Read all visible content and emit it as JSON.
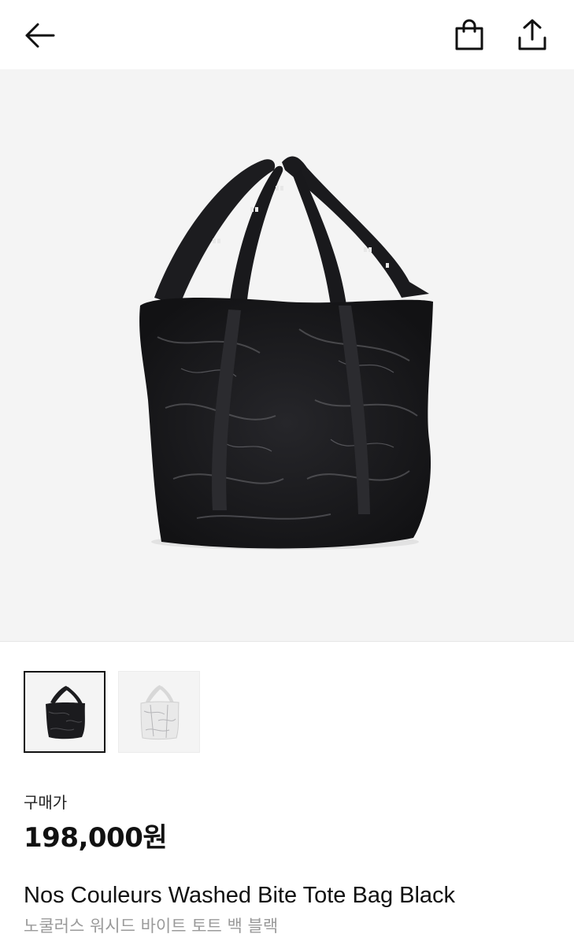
{
  "header": {
    "back_icon": "arrow-left-icon",
    "bag_icon": "shopping-bag-icon",
    "share_icon": "share-upload-icon"
  },
  "gallery": {
    "main_image": "black-washed-tote-bag-photo",
    "thumbnails": [
      {
        "image": "black-tote-thumbnail",
        "selected": true
      },
      {
        "image": "white-tote-thumbnail",
        "selected": false
      }
    ]
  },
  "product": {
    "price_label": "구매가",
    "price": "198,000원",
    "name_en": "Nos Couleurs Washed Bite Tote Bag Black",
    "name_ko": "노쿨러스 워시드 바이트 토트 백 블랙"
  },
  "colors": {
    "background": "#ffffff",
    "hero_background": "#f4f4f4",
    "bag_black": "#1b1b1e",
    "subtitle_gray": "#9a9a9a"
  }
}
